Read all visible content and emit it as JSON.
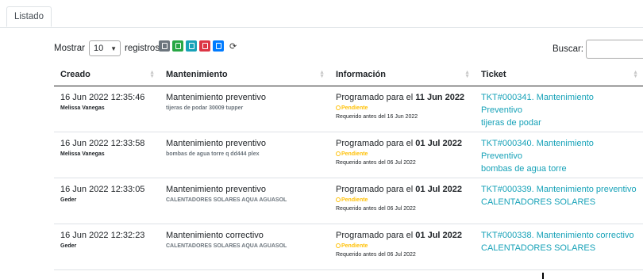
{
  "tabs": [
    {
      "label": "Listado",
      "active": true
    }
  ],
  "controls": {
    "show_label": "Mostrar",
    "page_length": "10",
    "records_label": "registros",
    "search_label": "Buscar:",
    "search_value": ""
  },
  "export_buttons": [
    {
      "name": "copy",
      "color": "#6c757d"
    },
    {
      "name": "excel",
      "color": "#28a745"
    },
    {
      "name": "csv",
      "color": "#17a2b8"
    },
    {
      "name": "pdf",
      "color": "#dc3545"
    },
    {
      "name": "print",
      "color": "#007bff"
    }
  ],
  "table": {
    "columns": [
      "Creado",
      "Mantenimiento",
      "Información",
      "Ticket"
    ],
    "rows": [
      {
        "created": "16 Jun 2022 12:35:46",
        "user": "Melissa Vanegas",
        "maint_type": "Mantenimiento preventivo",
        "maint_desc": "tijeras de podar 30009 tupper",
        "info_prefix": "Programado para el ",
        "info_date": "11 Jun 2022",
        "status": "Pendiente",
        "required": "Requerido antes del 16 Jun 2022",
        "ticket_line1": "TKT#000341. Mantenimiento Preventivo",
        "ticket_line2": "tijeras de podar"
      },
      {
        "created": "16 Jun 2022 12:33:58",
        "user": "Melissa Vanegas",
        "maint_type": "Mantenimiento preventivo",
        "maint_desc": "bombas de agua torre q dd444 plex",
        "info_prefix": "Programado para el ",
        "info_date": "01 Jul 2022",
        "status": "Pendiente",
        "required": "Requerido antes del 06 Jul 2022",
        "ticket_line1": "TKT#000340. Mantenimiento Preventivo",
        "ticket_line2": "bombas de agua torre"
      },
      {
        "created": "16 Jun 2022 12:33:05",
        "user": "Geder",
        "maint_type": "Mantenimiento preventivo",
        "maint_desc": "CALENTADORES SOLARES AQUA AGUASOL",
        "info_prefix": "Programado para el ",
        "info_date": "01 Jul 2022",
        "status": "Pendiente",
        "required": "Requerido antes del 06 Jul 2022",
        "ticket_line1": "TKT#000339. Mantenimiento preventivo",
        "ticket_line2": "CALENTADORES SOLARES"
      },
      {
        "created": "16 Jun 2022 12:32:23",
        "user": "Geder",
        "maint_type": "Mantenimiento correctivo",
        "maint_desc": "CALENTADORES SOLARES AQUA AGUASOL",
        "info_prefix": "Programado para el ",
        "info_date": "01 Jul 2022",
        "status": "Pendiente",
        "required": "Requerido antes del 06 Jul 2022",
        "ticket_line1": "TKT#000338. Mantenimiento correctivo",
        "ticket_line2": "CALENTADORES SOLARES"
      }
    ]
  },
  "colors": {
    "accent_link": "#17a2b8",
    "status_pending": "#ffc107"
  }
}
